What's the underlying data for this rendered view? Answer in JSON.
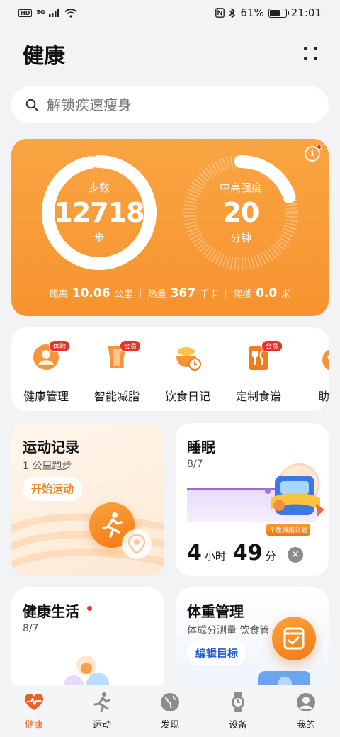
{
  "status_bar": {
    "hd": "HD",
    "network": "5G",
    "battery": "61%",
    "time": "21:01"
  },
  "header": {
    "title": "健康"
  },
  "search": {
    "placeholder": "解锁疾速瘦身"
  },
  "activity": {
    "steps": {
      "label": "步数",
      "value": "12718",
      "unit": "步",
      "progress": 0.97
    },
    "intensity": {
      "label": "中高强度",
      "value": "20",
      "unit": "分钟",
      "progress": 0.2
    },
    "stats": [
      {
        "label": "距离",
        "value": "10.06",
        "unit": "公里"
      },
      {
        "label": "热量",
        "value": "367",
        "unit": "千卡"
      },
      {
        "label": "爬楼",
        "value": "0.0",
        "unit": "米"
      }
    ],
    "colors": {
      "card": "#f7932f",
      "ring": "#ffffff"
    }
  },
  "services": [
    {
      "label": "健康管理",
      "icon": "health-manage-icon",
      "badge": "体验"
    },
    {
      "label": "智能减脂",
      "icon": "fat-loss-icon",
      "badge": "会员"
    },
    {
      "label": "饮食日记",
      "icon": "diet-diary-icon",
      "badge": ""
    },
    {
      "label": "定制食谱",
      "icon": "recipe-icon",
      "badge": "会员"
    },
    {
      "label": "助眠",
      "icon": "sleep-aid-icon",
      "badge": ""
    }
  ],
  "exercise": {
    "title": "运动记录",
    "subtitle": "1 公里跑步",
    "button": "开始运动"
  },
  "sleep": {
    "title": "睡眠",
    "date": "8/7",
    "hours": "4",
    "hours_unit": "小时",
    "minutes": "49",
    "minutes_unit": "分",
    "promo": "个性减脂计划"
  },
  "life": {
    "title": "健康生活",
    "date": "8/7"
  },
  "weight": {
    "title": "体重管理",
    "subtitle": "体成分测量 饮食管",
    "button": "编辑目标"
  },
  "bottom_nav": [
    {
      "label": "健康",
      "icon": "heart-pulse-icon",
      "active": true
    },
    {
      "label": "运动",
      "icon": "runner-icon",
      "active": false
    },
    {
      "label": "发现",
      "icon": "globe-icon",
      "active": false
    },
    {
      "label": "设备",
      "icon": "watch-icon",
      "active": false
    },
    {
      "label": "我的",
      "icon": "profile-icon",
      "active": false
    }
  ]
}
